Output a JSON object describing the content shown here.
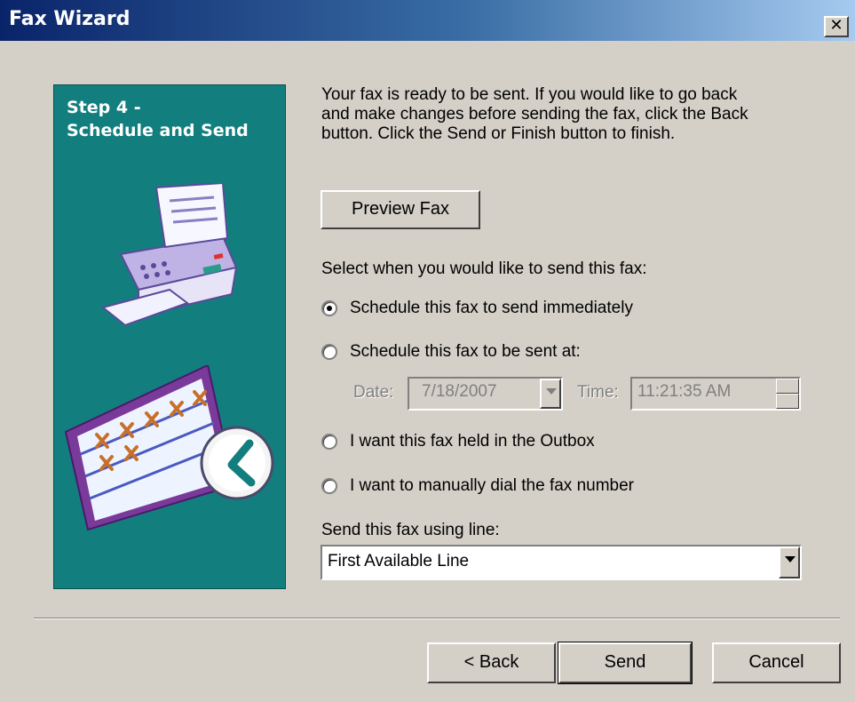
{
  "window": {
    "title": "Fax Wizard",
    "close_glyph": "✕",
    "close_icon": "close-icon"
  },
  "side": {
    "step_title": "Step 4 -\nSchedule and Send",
    "bg_color": "#137e7e",
    "images": [
      "fax-machine-icon",
      "schedule-calendar-icon"
    ]
  },
  "intro_text": "Your fax is ready to be sent.  If you would like to go back and make changes before sending the fax, click the Back button.  Click the Send or Finish button to finish.",
  "preview_button": "Preview Fax",
  "when_label": "Select when you would like to send this fax:",
  "options": [
    {
      "label": "Schedule this fax to send immediately",
      "checked": true
    },
    {
      "label": "Schedule this fax to be sent at:",
      "checked": false
    },
    {
      "label": "I want this fax held in the Outbox",
      "checked": false
    },
    {
      "label": "I want to manually dial the fax number",
      "checked": false
    }
  ],
  "schedule": {
    "date_label": "Date:",
    "date_value": "7/18/2007",
    "time_label": "Time:",
    "time_value": "11:21:35 AM",
    "enabled": false
  },
  "line": {
    "label": "Send this fax using line:",
    "value": "First Available Line"
  },
  "footer": {
    "back": "< Back",
    "send": "Send",
    "cancel": "Cancel"
  }
}
